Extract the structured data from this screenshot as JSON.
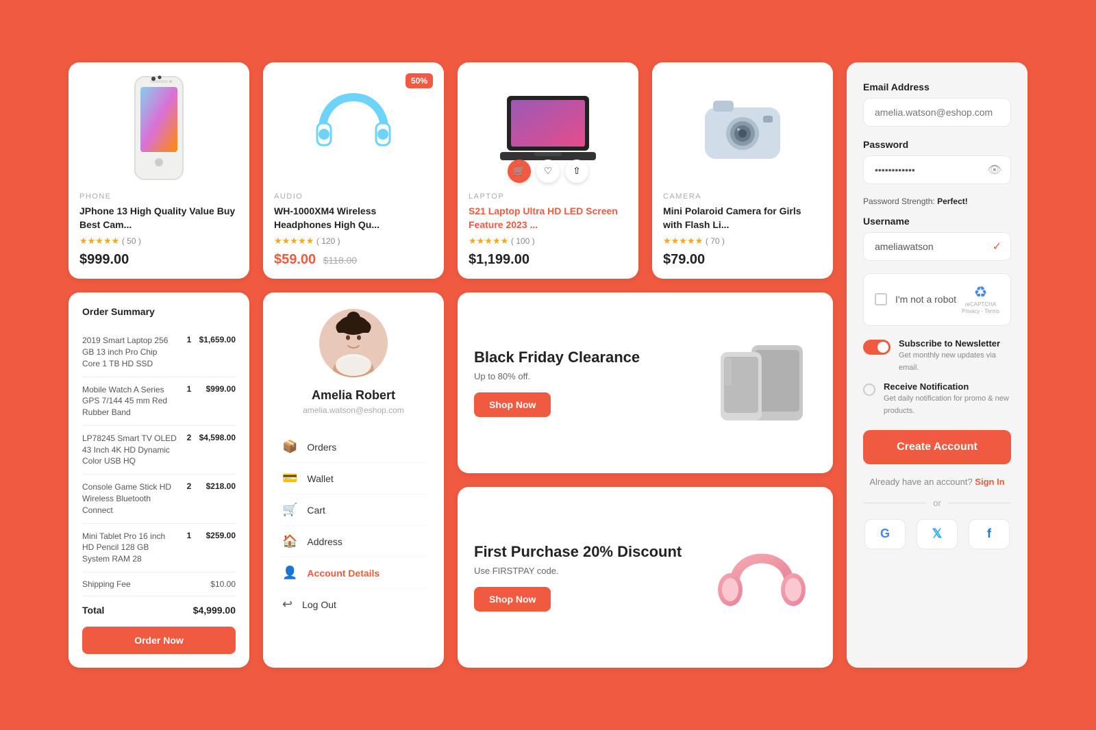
{
  "products": [
    {
      "id": "phone",
      "category": "PHONE",
      "title": "JPhone 13 High Quality Value Buy Best Cam...",
      "rating": 5,
      "review_count": "50",
      "price": "$999.00",
      "badge": null,
      "actions": false,
      "title_link": false
    },
    {
      "id": "headphones",
      "category": "AUDIO",
      "title": "WH-1000XM4 Wireless Headphones High Qu...",
      "rating": 5,
      "review_count": "120",
      "price": "$59.00",
      "price_original": "$118.00",
      "badge": "50%",
      "actions": false,
      "title_link": false
    },
    {
      "id": "laptop",
      "category": "LAPTOP",
      "title": "S21 Laptop Ultra HD LED Screen Feature 2023 ...",
      "rating": 5,
      "review_count": "100",
      "price": "$1,199.00",
      "badge": null,
      "actions": true,
      "title_link": true
    },
    {
      "id": "camera",
      "category": "CAMERA",
      "title": "Mini Polaroid Camera for Girls with Flash Li...",
      "rating": 5,
      "review_count": "70",
      "price": "$79.00",
      "badge": null,
      "actions": false,
      "title_link": false
    }
  ],
  "account": {
    "title": "Email Address",
    "email_placeholder": "amelia.watson@eshop.com",
    "password_label": "Password",
    "password_value": "············",
    "password_strength_label": "Password Strength:",
    "password_strength_value": "Perfect!",
    "username_label": "Username",
    "username_value": "ameliawatson",
    "captcha_text": "I'm not a robot",
    "subscribe_label": "Subscribe to Newsletter",
    "subscribe_sub": "Get monthly new updates via email.",
    "notify_label": "Receive Notification",
    "notify_sub": "Get daily notification for promo & new products.",
    "create_btn": "Create Account",
    "signin_text": "Already have an account?",
    "signin_link": "Sign In",
    "or_text": "or",
    "social_google": "G",
    "social_twitter": "𝕏",
    "social_facebook": "f"
  },
  "order": {
    "title": "Order Summary",
    "items": [
      {
        "name": "2019 Smart Laptop 256 GB 13 inch Pro Chip Core 1 TB HD SSD",
        "qty": "1",
        "price": "$1,659.00"
      },
      {
        "name": "Mobile Watch A Series GPS 7/144 45 mm Red Rubber Band",
        "qty": "1",
        "price": "$999.00"
      },
      {
        "name": "LP78245 Smart TV OLED 43 Inch 4K HD Dynamic Color USB HQ",
        "qty": "2",
        "price": "$4,598.00"
      },
      {
        "name": "Console Game Stick HD Wireless Bluetooth Connect",
        "qty": "2",
        "price": "$218.00"
      },
      {
        "name": "Mini Tablet Pro 16 inch HD Pencil 128 GB System RAM 28",
        "qty": "1",
        "price": "$259.00"
      }
    ],
    "shipping_label": "Shipping Fee",
    "shipping_price": "$10.00",
    "total_label": "Total",
    "total_price": "$4,999.00",
    "order_btn": "Order Now"
  },
  "profile": {
    "name": "Amelia Robert",
    "email": "amelia.watson@eshop.com",
    "menu": [
      {
        "label": "Orders",
        "icon": "📦",
        "active": false
      },
      {
        "label": "Wallet",
        "icon": "💳",
        "active": false
      },
      {
        "label": "Cart",
        "icon": "🛒",
        "active": false
      },
      {
        "label": "Address",
        "icon": "🏠",
        "active": false
      },
      {
        "label": "Account Details",
        "icon": "👤",
        "active": true
      },
      {
        "label": "Log Out",
        "icon": "↩",
        "active": false
      }
    ]
  },
  "promos": [
    {
      "id": "black-friday",
      "heading": "Black Friday Clearance",
      "subtext": "Up to 80% off.",
      "btn": "Shop Now"
    },
    {
      "id": "first-purchase",
      "heading": "First Purchase 20% Discount",
      "subtext": "Use FIRSTPAY code.",
      "btn": "Shop Now"
    }
  ]
}
